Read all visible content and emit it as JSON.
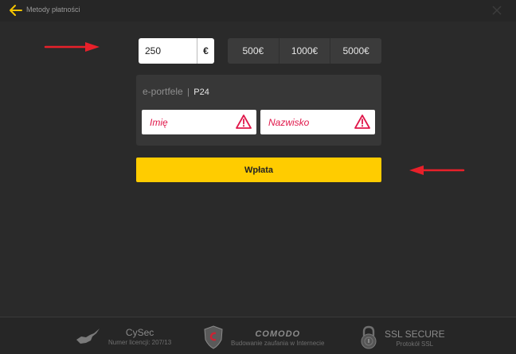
{
  "header": {
    "back_icon": "back-arrow-icon",
    "title": "Metody płatności",
    "close_icon": "close-icon"
  },
  "amount": {
    "value": "250",
    "currency": "€"
  },
  "presets": [
    {
      "label": "500€"
    },
    {
      "label": "1000€"
    },
    {
      "label": "5000€"
    }
  ],
  "method": {
    "category": "e-portfele",
    "separator": "|",
    "provider": "P24",
    "first_name_placeholder": "Imię",
    "last_name_placeholder": "Nazwisko",
    "warning_icon": "warning-icon"
  },
  "submit_label": "Wpłata",
  "colors": {
    "accent": "#ffcc00",
    "error": "#e0174a",
    "annotation_arrow": "#e8202a"
  },
  "footer": {
    "cysec": {
      "title": "CySec",
      "sub": "Numer licencji: 207/13",
      "icon": "cyprus-map-icon"
    },
    "comodo": {
      "title": "COMODO",
      "sub": "Budowanie zaufania w Internecie",
      "icon": "shield-icon"
    },
    "ssl": {
      "title": "SSL SECURE",
      "sub": "Protokół SSL",
      "icon": "padlock-icon"
    }
  }
}
